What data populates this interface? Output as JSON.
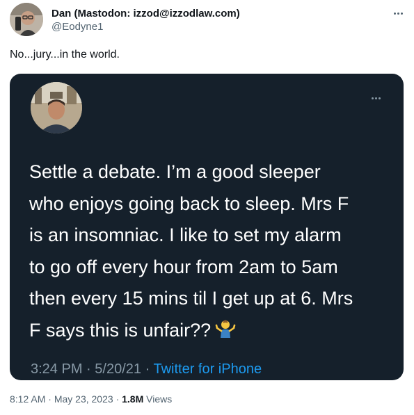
{
  "author": {
    "display_name": "Dan (Mastodon: izzod@izzodlaw.com)",
    "handle": "@Eodyne1"
  },
  "tweet": {
    "text": "No...jury...in the world."
  },
  "quoted_image": {
    "lines": [
      "Settle a debate. I’m a good sleeper",
      "who enjoys going back to sleep. Mrs F",
      "is an insomniac. I like to set my alarm",
      "to go off every hour from 2am to 5am",
      "then every 15 mins til I get up at 6. Mrs",
      "F says this is unfair??"
    ],
    "time": "3:24 PM",
    "date": "5/20/21",
    "separator": "·",
    "source": "Twitter for iPhone",
    "emoji_icon": "person-shrugging-icon"
  },
  "meta": {
    "time": "8:12 AM",
    "date": "May 23, 2023",
    "separator": "·",
    "views_count": "1.8M",
    "views_label": "Views"
  },
  "colors": {
    "card_background": "#15202b",
    "link_blue": "#1d9bf0",
    "muted_text": "#536471"
  }
}
